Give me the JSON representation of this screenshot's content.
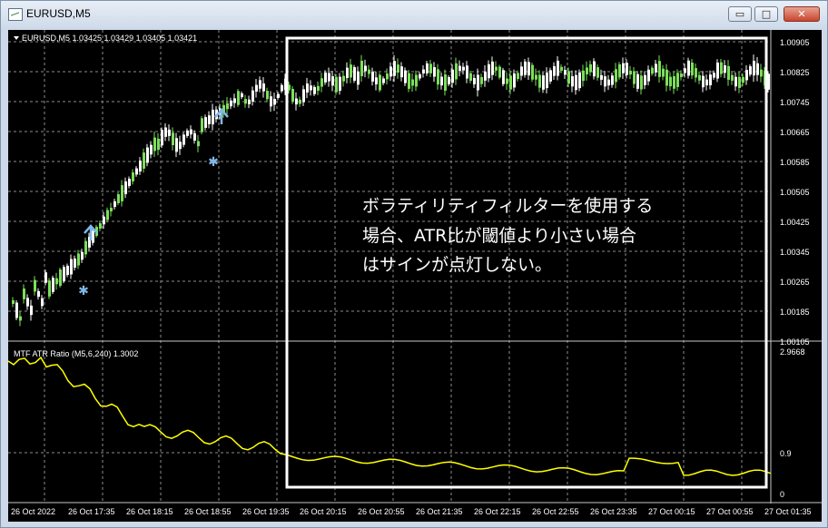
{
  "window": {
    "title": "EURUSD,M5",
    "minimize_glyph": "▭",
    "maximize_glyph": "□",
    "close_glyph": "✕"
  },
  "main_chart": {
    "header": "EURUSD,M5  1.03425 1.03429 1.03405 1.03421",
    "price_ticks": [
      "1.00905",
      "1.00825",
      "1.00745",
      "1.00665",
      "1.00585",
      "1.00505",
      "1.00425",
      "1.00345",
      "1.00265",
      "1.00185",
      "1.00105"
    ],
    "markers": {
      "star": "✱"
    }
  },
  "indicator": {
    "header": "MTF ATR Ratio  (M5,6,240) 1.3002",
    "ticks": [
      "2.9668",
      "0.9",
      "0"
    ]
  },
  "time_axis": [
    "26 Oct 2022",
    "26 Oct 17:35",
    "26 Oct 18:15",
    "26 Oct 18:55",
    "26 Oct 19:35",
    "26 Oct 20:15",
    "26 Oct 20:55",
    "26 Oct 21:35",
    "26 Oct 22:15",
    "26 Oct 22:55",
    "26 Oct 23:35",
    "27 Oct 00:15",
    "27 Oct 00:55",
    "27 Oct 01:35"
  ],
  "annotation": {
    "lines": [
      "ボラティリティフィルターを使用する",
      "場合、ATR比が閾値より小さい場合",
      "はサインが点灯しない。"
    ]
  },
  "colors": {
    "background": "#000000",
    "grid": "#8c8c8c",
    "bull": "#ffffff",
    "bear": "#7cdf5a",
    "atr_line": "#ffff00",
    "arrow": "#7fb8e8",
    "annotation_border": "#ffffff"
  }
}
